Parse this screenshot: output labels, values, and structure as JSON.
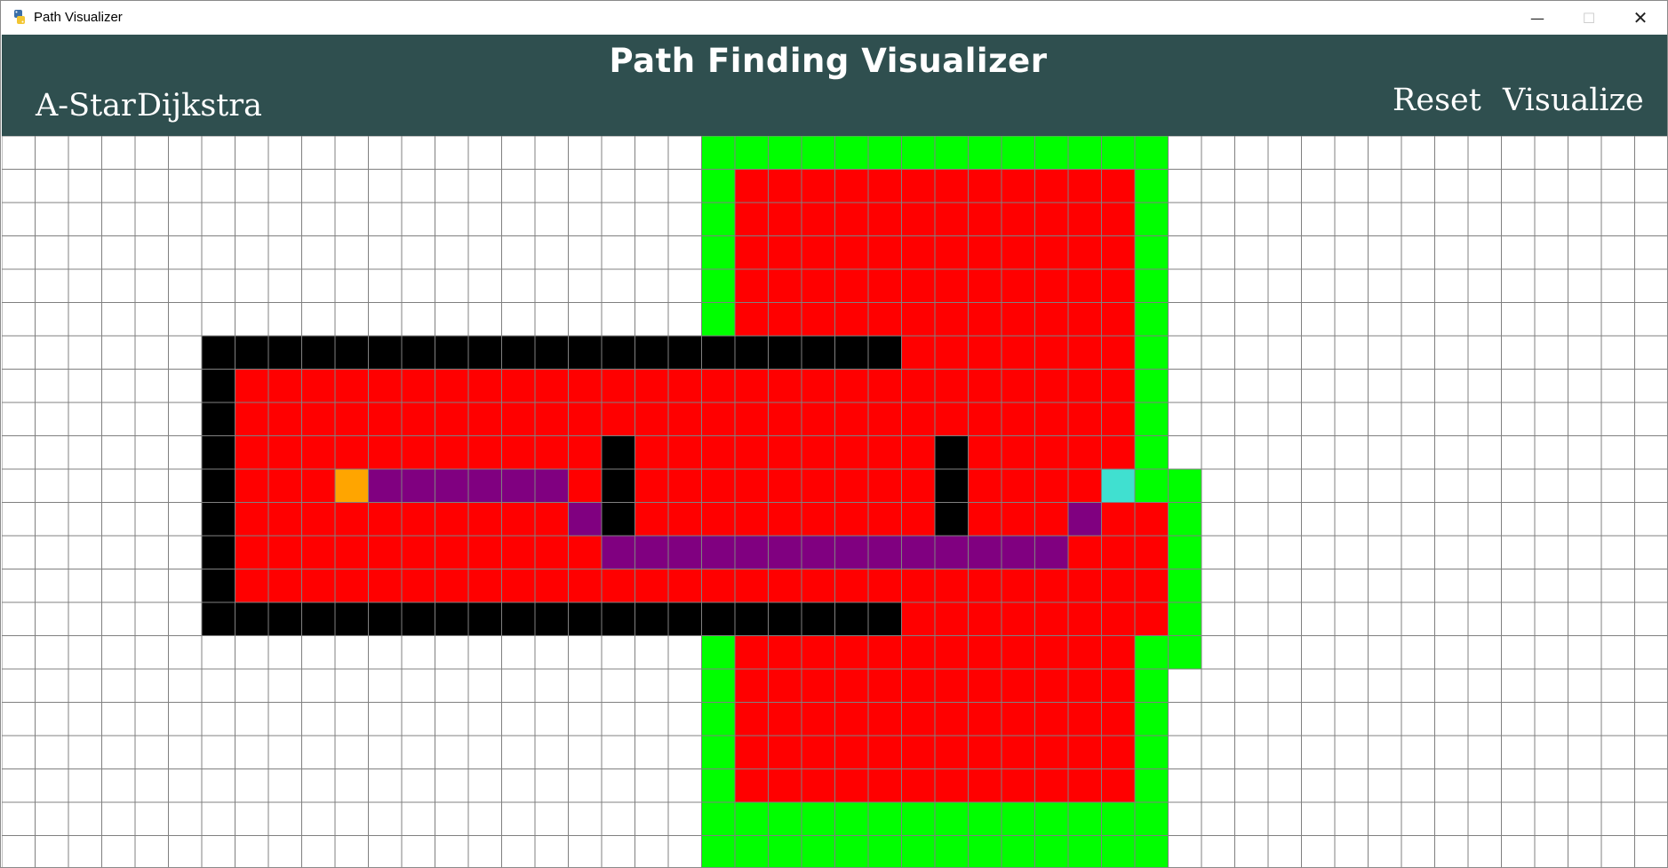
{
  "window": {
    "title": "Path Visualizer",
    "app_icon": "python-icon",
    "controls": {
      "minimize": "—",
      "maximize": "☐",
      "close": "✕"
    }
  },
  "header": {
    "title": "Path Finding Visualizer",
    "buttons": {
      "astar": "A-Star",
      "dijkstra": "Dijkstra",
      "reset": "Reset",
      "visualize": "Visualize"
    }
  },
  "colors": {
    "header_bg": "#2f4f4f",
    "header_text": "#ffffff",
    "grid_line": "#808080",
    "empty": "#ffffff",
    "visited": "#ff0000",
    "frontier": "#00ff00",
    "wall": "#000000",
    "path": "#800080",
    "start": "#ffa500",
    "end": "#40e0d0"
  },
  "grid": {
    "cols": 50,
    "rows": 22,
    "frontier_rects": [
      [
        21,
        0,
        34,
        21
      ],
      [
        34,
        10,
        35,
        15
      ]
    ],
    "visited_rects": [
      [
        22,
        1,
        33,
        19
      ],
      [
        7,
        7,
        33,
        14
      ],
      [
        33,
        11,
        34,
        14
      ]
    ],
    "wall_rects": [
      [
        6,
        6,
        26,
        6
      ],
      [
        6,
        14,
        26,
        14
      ],
      [
        6,
        7,
        6,
        13
      ],
      [
        18,
        9,
        18,
        11
      ],
      [
        28,
        9,
        28,
        11
      ]
    ],
    "path_cells": [
      [
        11,
        10
      ],
      [
        12,
        10
      ],
      [
        13,
        10
      ],
      [
        14,
        10
      ],
      [
        15,
        10
      ],
      [
        16,
        10
      ],
      [
        17,
        11
      ],
      [
        18,
        12
      ],
      [
        19,
        12
      ],
      [
        20,
        12
      ],
      [
        21,
        12
      ],
      [
        22,
        12
      ],
      [
        23,
        12
      ],
      [
        24,
        12
      ],
      [
        25,
        12
      ],
      [
        26,
        12
      ],
      [
        27,
        12
      ],
      [
        28,
        12
      ],
      [
        29,
        12
      ],
      [
        30,
        12
      ],
      [
        31,
        12
      ],
      [
        32,
        11
      ]
    ],
    "start_cell": [
      10,
      10
    ],
    "end_cell": [
      33,
      10
    ]
  }
}
